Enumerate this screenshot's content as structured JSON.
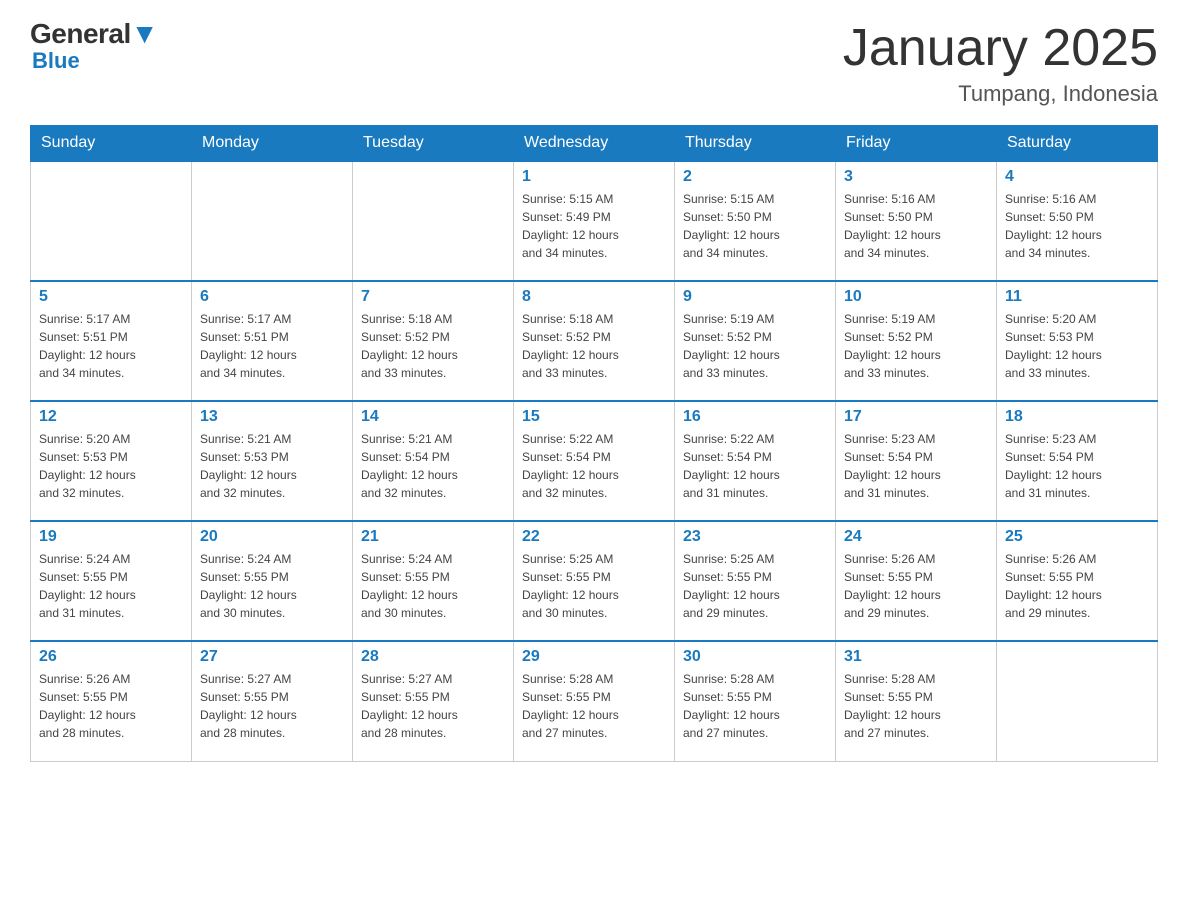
{
  "logo": {
    "general": "General",
    "triangle": "▼",
    "blue": "Blue"
  },
  "header": {
    "month": "January 2025",
    "location": "Tumpang, Indonesia"
  },
  "days": [
    "Sunday",
    "Monday",
    "Tuesday",
    "Wednesday",
    "Thursday",
    "Friday",
    "Saturday"
  ],
  "weeks": [
    [
      {
        "day": "",
        "info": ""
      },
      {
        "day": "",
        "info": ""
      },
      {
        "day": "",
        "info": ""
      },
      {
        "day": "1",
        "info": "Sunrise: 5:15 AM\nSunset: 5:49 PM\nDaylight: 12 hours\nand 34 minutes."
      },
      {
        "day": "2",
        "info": "Sunrise: 5:15 AM\nSunset: 5:50 PM\nDaylight: 12 hours\nand 34 minutes."
      },
      {
        "day": "3",
        "info": "Sunrise: 5:16 AM\nSunset: 5:50 PM\nDaylight: 12 hours\nand 34 minutes."
      },
      {
        "day": "4",
        "info": "Sunrise: 5:16 AM\nSunset: 5:50 PM\nDaylight: 12 hours\nand 34 minutes."
      }
    ],
    [
      {
        "day": "5",
        "info": "Sunrise: 5:17 AM\nSunset: 5:51 PM\nDaylight: 12 hours\nand 34 minutes."
      },
      {
        "day": "6",
        "info": "Sunrise: 5:17 AM\nSunset: 5:51 PM\nDaylight: 12 hours\nand 34 minutes."
      },
      {
        "day": "7",
        "info": "Sunrise: 5:18 AM\nSunset: 5:52 PM\nDaylight: 12 hours\nand 33 minutes."
      },
      {
        "day": "8",
        "info": "Sunrise: 5:18 AM\nSunset: 5:52 PM\nDaylight: 12 hours\nand 33 minutes."
      },
      {
        "day": "9",
        "info": "Sunrise: 5:19 AM\nSunset: 5:52 PM\nDaylight: 12 hours\nand 33 minutes."
      },
      {
        "day": "10",
        "info": "Sunrise: 5:19 AM\nSunset: 5:52 PM\nDaylight: 12 hours\nand 33 minutes."
      },
      {
        "day": "11",
        "info": "Sunrise: 5:20 AM\nSunset: 5:53 PM\nDaylight: 12 hours\nand 33 minutes."
      }
    ],
    [
      {
        "day": "12",
        "info": "Sunrise: 5:20 AM\nSunset: 5:53 PM\nDaylight: 12 hours\nand 32 minutes."
      },
      {
        "day": "13",
        "info": "Sunrise: 5:21 AM\nSunset: 5:53 PM\nDaylight: 12 hours\nand 32 minutes."
      },
      {
        "day": "14",
        "info": "Sunrise: 5:21 AM\nSunset: 5:54 PM\nDaylight: 12 hours\nand 32 minutes."
      },
      {
        "day": "15",
        "info": "Sunrise: 5:22 AM\nSunset: 5:54 PM\nDaylight: 12 hours\nand 32 minutes."
      },
      {
        "day": "16",
        "info": "Sunrise: 5:22 AM\nSunset: 5:54 PM\nDaylight: 12 hours\nand 31 minutes."
      },
      {
        "day": "17",
        "info": "Sunrise: 5:23 AM\nSunset: 5:54 PM\nDaylight: 12 hours\nand 31 minutes."
      },
      {
        "day": "18",
        "info": "Sunrise: 5:23 AM\nSunset: 5:54 PM\nDaylight: 12 hours\nand 31 minutes."
      }
    ],
    [
      {
        "day": "19",
        "info": "Sunrise: 5:24 AM\nSunset: 5:55 PM\nDaylight: 12 hours\nand 31 minutes."
      },
      {
        "day": "20",
        "info": "Sunrise: 5:24 AM\nSunset: 5:55 PM\nDaylight: 12 hours\nand 30 minutes."
      },
      {
        "day": "21",
        "info": "Sunrise: 5:24 AM\nSunset: 5:55 PM\nDaylight: 12 hours\nand 30 minutes."
      },
      {
        "day": "22",
        "info": "Sunrise: 5:25 AM\nSunset: 5:55 PM\nDaylight: 12 hours\nand 30 minutes."
      },
      {
        "day": "23",
        "info": "Sunrise: 5:25 AM\nSunset: 5:55 PM\nDaylight: 12 hours\nand 29 minutes."
      },
      {
        "day": "24",
        "info": "Sunrise: 5:26 AM\nSunset: 5:55 PM\nDaylight: 12 hours\nand 29 minutes."
      },
      {
        "day": "25",
        "info": "Sunrise: 5:26 AM\nSunset: 5:55 PM\nDaylight: 12 hours\nand 29 minutes."
      }
    ],
    [
      {
        "day": "26",
        "info": "Sunrise: 5:26 AM\nSunset: 5:55 PM\nDaylight: 12 hours\nand 28 minutes."
      },
      {
        "day": "27",
        "info": "Sunrise: 5:27 AM\nSunset: 5:55 PM\nDaylight: 12 hours\nand 28 minutes."
      },
      {
        "day": "28",
        "info": "Sunrise: 5:27 AM\nSunset: 5:55 PM\nDaylight: 12 hours\nand 28 minutes."
      },
      {
        "day": "29",
        "info": "Sunrise: 5:28 AM\nSunset: 5:55 PM\nDaylight: 12 hours\nand 27 minutes."
      },
      {
        "day": "30",
        "info": "Sunrise: 5:28 AM\nSunset: 5:55 PM\nDaylight: 12 hours\nand 27 minutes."
      },
      {
        "day": "31",
        "info": "Sunrise: 5:28 AM\nSunset: 5:55 PM\nDaylight: 12 hours\nand 27 minutes."
      },
      {
        "day": "",
        "info": ""
      }
    ]
  ]
}
